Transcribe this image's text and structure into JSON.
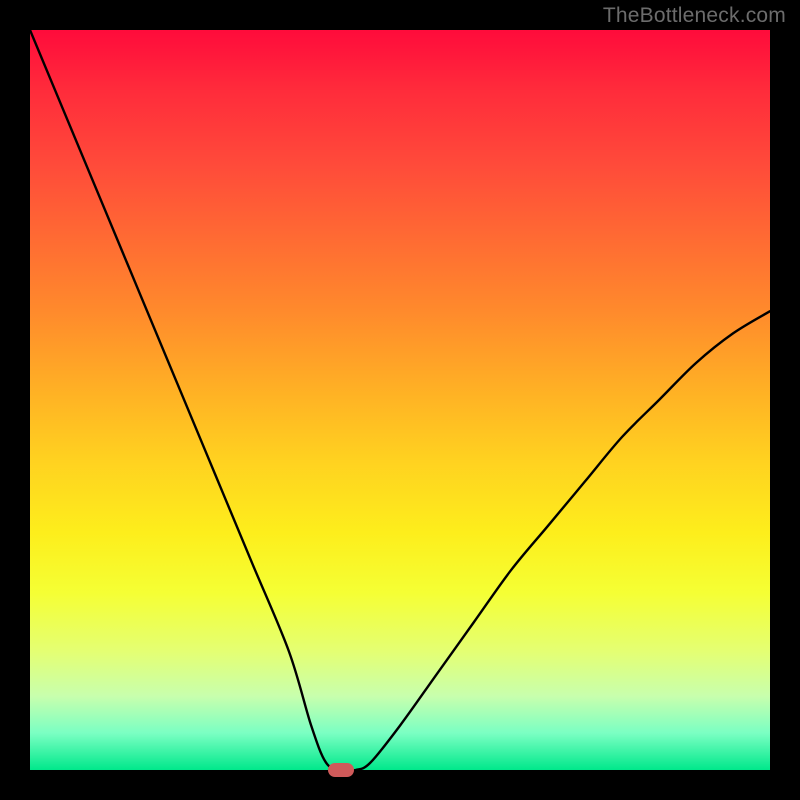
{
  "watermark": "TheBottleneck.com",
  "chart_data": {
    "type": "line",
    "title": "",
    "xlabel": "",
    "ylabel": "",
    "xlim": [
      0,
      100
    ],
    "ylim": [
      0,
      100
    ],
    "grid": false,
    "legend": false,
    "background_gradient": {
      "direction": "vertical",
      "stops": [
        {
          "t": 0.0,
          "color": "#ff0b3b"
        },
        {
          "t": 0.18,
          "color": "#ff4a3a"
        },
        {
          "t": 0.38,
          "color": "#ff8a2c"
        },
        {
          "t": 0.58,
          "color": "#ffd120"
        },
        {
          "t": 0.76,
          "color": "#f5ff34"
        },
        {
          "t": 0.9,
          "color": "#c8ffad"
        },
        {
          "t": 1.0,
          "color": "#00e88b"
        }
      ]
    },
    "series": [
      {
        "name": "bottleneck-curve",
        "x": [
          0,
          5,
          10,
          15,
          20,
          25,
          30,
          35,
          38,
          40,
          42,
          44,
          46,
          50,
          55,
          60,
          65,
          70,
          75,
          80,
          85,
          90,
          95,
          100
        ],
        "y": [
          100,
          88,
          76,
          64,
          52,
          40,
          28,
          16,
          6,
          1,
          0,
          0,
          1,
          6,
          13,
          20,
          27,
          33,
          39,
          45,
          50,
          55,
          59,
          62
        ]
      }
    ],
    "marker": {
      "name": "bottleneck-point",
      "x": 42,
      "y": 0,
      "color": "#cf5a5a",
      "shape": "pill"
    }
  }
}
